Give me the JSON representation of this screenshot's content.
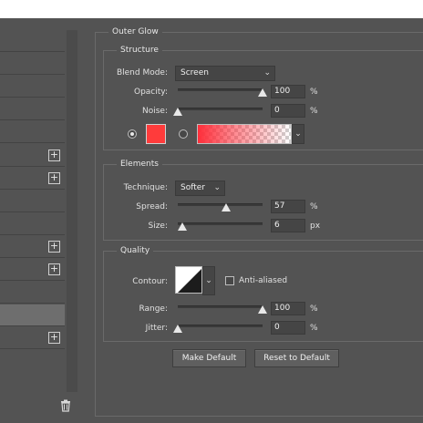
{
  "panel": {
    "title": "Outer Glow"
  },
  "structure": {
    "title": "Structure",
    "blend_mode_label": "Blend Mode:",
    "blend_mode_value": "Screen",
    "opacity_label": "Opacity:",
    "opacity_value": "100",
    "noise_label": "Noise:",
    "noise_value": "0",
    "percent": "%",
    "color_hex": "#ff3b3b",
    "selected_fill": "color"
  },
  "elements": {
    "title": "Elements",
    "technique_label": "Technique:",
    "technique_value": "Softer",
    "spread_label": "Spread:",
    "spread_value": "57",
    "size_label": "Size:",
    "size_value": "6",
    "percent": "%",
    "px": "px"
  },
  "quality": {
    "title": "Quality",
    "contour_label": "Contour:",
    "anti_aliased_label": "Anti-aliased",
    "anti_aliased_checked": false,
    "range_label": "Range:",
    "range_value": "100",
    "jitter_label": "Jitter:",
    "jitter_value": "0",
    "percent": "%"
  },
  "buttons": {
    "make_default": "Make Default",
    "reset_default": "Reset to Default"
  },
  "icons": {
    "add": "plus-box-icon",
    "delete": "trash-icon",
    "dropdown": "chevron-down-icon"
  }
}
